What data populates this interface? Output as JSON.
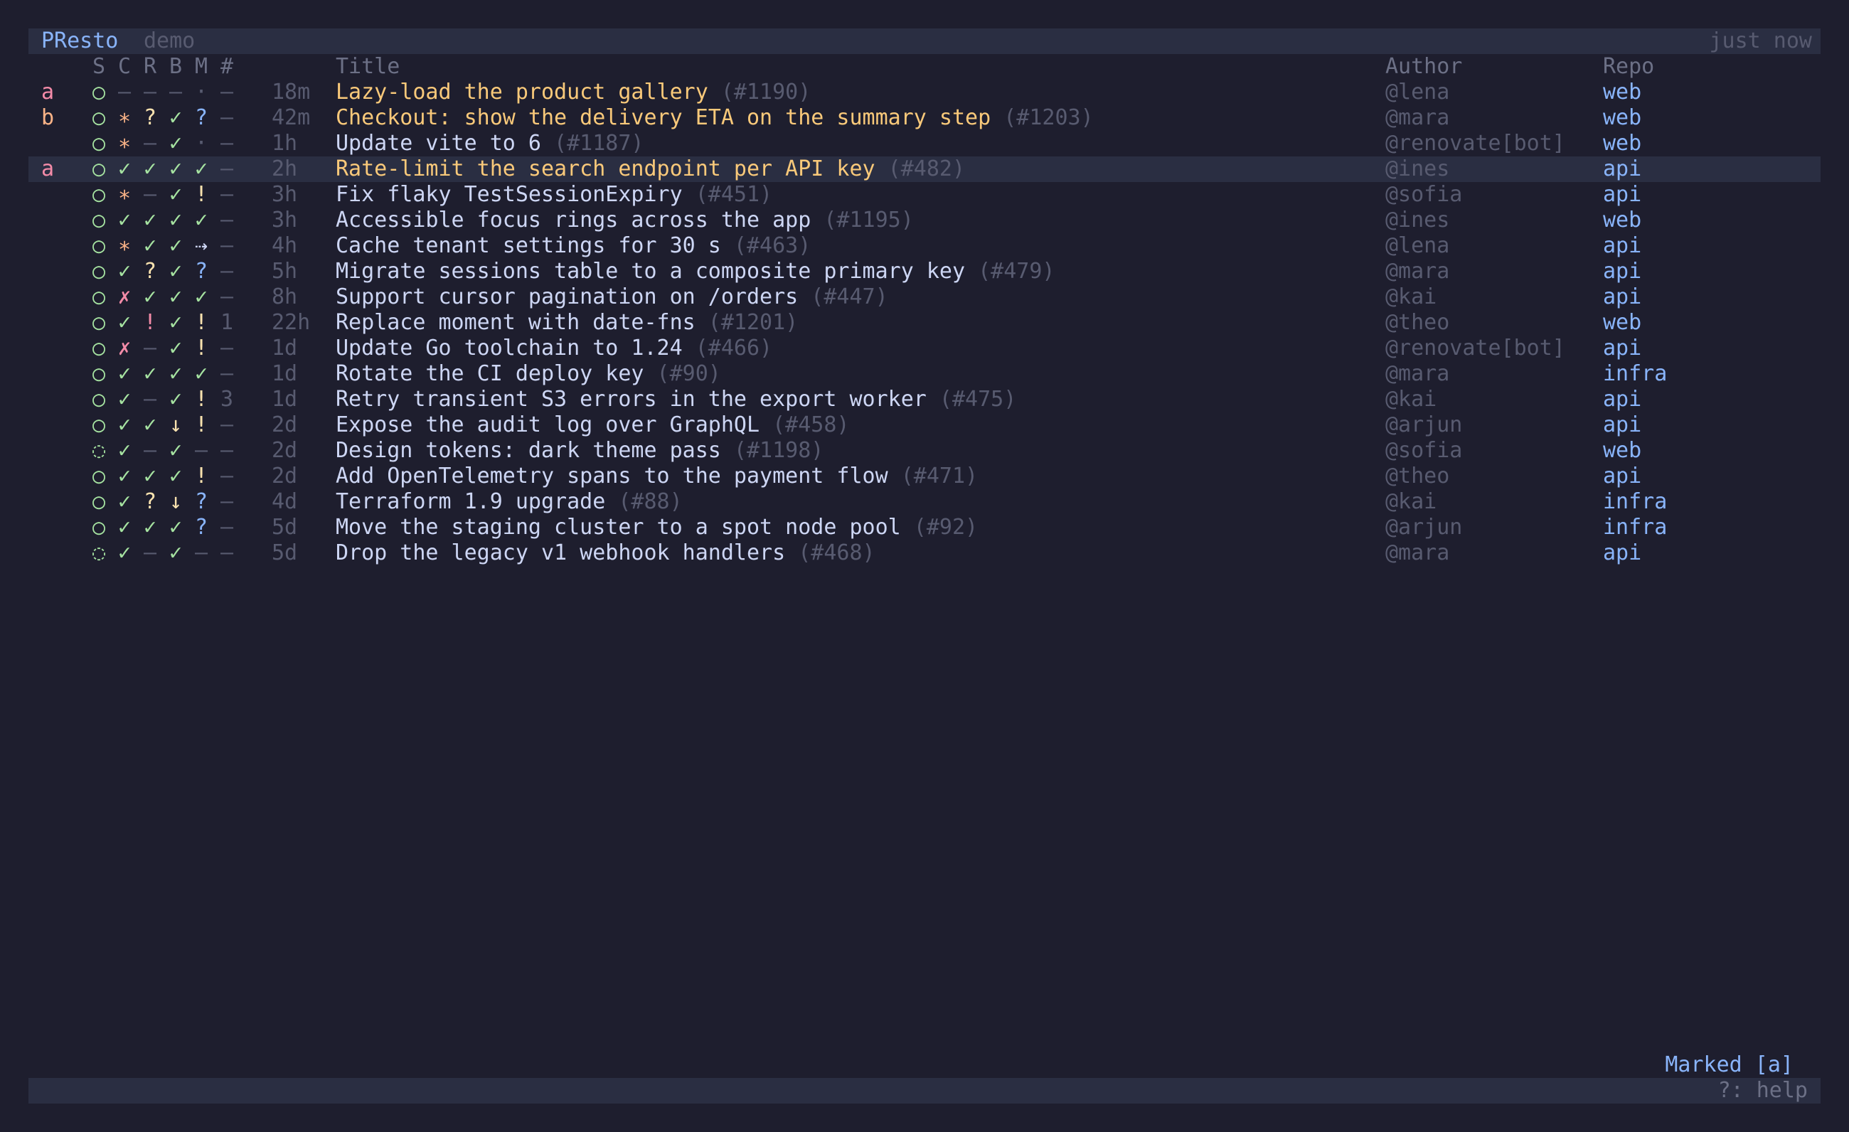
{
  "header": {
    "app_name": "PResto",
    "subtitle": "demo",
    "updated": "just now"
  },
  "columns": {
    "status": "S",
    "ci": "C",
    "review": "R",
    "branch": "B",
    "merge": "M",
    "count": "#",
    "title": "Title",
    "author": "Author",
    "repo": "Repo"
  },
  "colors": {
    "background": "#1e1e2e",
    "bar": "#2a2e42",
    "accent_blue": "#89b4fa",
    "green": "#a6e3a1",
    "yellow": "#f9e2af",
    "orange": "#fab387",
    "red": "#f38ba8",
    "dim": "#585b70"
  },
  "rows": [
    {
      "mark": "a",
      "cells": [
        "○",
        "–",
        "–",
        "–",
        "·",
        "–"
      ],
      "age": "18m",
      "title": "Lazy-load the product gallery",
      "number": "(#1190)",
      "author": "@lena",
      "repo": "web",
      "marked": true
    },
    {
      "mark": "b",
      "cells": [
        "○",
        "∗",
        "?",
        "✓",
        "?",
        "–"
      ],
      "age": "42m",
      "title": "Checkout: show the delivery ETA on the summary step",
      "number": "(#1203)",
      "author": "@mara",
      "repo": "web",
      "marked": true
    },
    {
      "mark": "",
      "cells": [
        "○",
        "∗",
        "–",
        "✓",
        "·",
        "–"
      ],
      "age": "1h",
      "title": "Update vite to 6",
      "number": "(#1187)",
      "author": "@renovate[bot]",
      "repo": "web"
    },
    {
      "mark": "a",
      "cells": [
        "○",
        "✓",
        "✓",
        "✓",
        "✓",
        "–"
      ],
      "age": "2h",
      "title": "Rate-limit the search endpoint per API key",
      "number": "(#482)",
      "author": "@ines",
      "repo": "api",
      "marked": true,
      "selected": true
    },
    {
      "mark": "",
      "cells": [
        "○",
        "∗",
        "–",
        "✓",
        "!",
        "–"
      ],
      "age": "3h",
      "title": "Fix flaky TestSessionExpiry",
      "number": "(#451)",
      "author": "@sofia",
      "repo": "api"
    },
    {
      "mark": "",
      "cells": [
        "○",
        "✓",
        "✓",
        "✓",
        "✓",
        "–"
      ],
      "age": "3h",
      "title": "Accessible focus rings across the app",
      "number": "(#1195)",
      "author": "@ines",
      "repo": "web"
    },
    {
      "mark": "",
      "cells": [
        "○",
        "∗",
        "✓",
        "✓",
        "⇢",
        "–"
      ],
      "age": "4h",
      "title": "Cache tenant settings for 30 s",
      "number": "(#463)",
      "author": "@lena",
      "repo": "api"
    },
    {
      "mark": "",
      "cells": [
        "○",
        "✓",
        "?",
        "✓",
        "?",
        "–"
      ],
      "age": "5h",
      "title": "Migrate sessions table to a composite primary key",
      "number": "(#479)",
      "author": "@mara",
      "repo": "api"
    },
    {
      "mark": "",
      "cells": [
        "○",
        "✗",
        "✓",
        "✓",
        "✓",
        "–"
      ],
      "age": "8h",
      "title": "Support cursor pagination on /orders",
      "number": "(#447)",
      "author": "@kai",
      "repo": "api"
    },
    {
      "mark": "",
      "cells": [
        "○",
        "✓",
        "!",
        "✓",
        "!",
        "1"
      ],
      "age": "22h",
      "title": "Replace moment with date-fns",
      "number": "(#1201)",
      "author": "@theo",
      "repo": "web"
    },
    {
      "mark": "",
      "cells": [
        "○",
        "✗",
        "–",
        "✓",
        "!",
        "–"
      ],
      "age": "1d",
      "title": "Update Go toolchain to 1.24",
      "number": "(#466)",
      "author": "@renovate[bot]",
      "repo": "api"
    },
    {
      "mark": "",
      "cells": [
        "○",
        "✓",
        "✓",
        "✓",
        "✓",
        "–"
      ],
      "age": "1d",
      "title": "Rotate the CI deploy key",
      "number": "(#90)",
      "author": "@mara",
      "repo": "infra"
    },
    {
      "mark": "",
      "cells": [
        "○",
        "✓",
        "–",
        "✓",
        "!",
        "3"
      ],
      "age": "1d",
      "title": "Retry transient S3 errors in the export worker",
      "number": "(#475)",
      "author": "@kai",
      "repo": "api"
    },
    {
      "mark": "",
      "cells": [
        "○",
        "✓",
        "✓",
        "↓",
        "!",
        "–"
      ],
      "age": "2d",
      "title": "Expose the audit log over GraphQL",
      "number": "(#458)",
      "author": "@arjun",
      "repo": "api"
    },
    {
      "mark": "",
      "cells": [
        "◌",
        "✓",
        "–",
        "✓",
        "–",
        "–"
      ],
      "age": "2d",
      "title": "Design tokens: dark theme pass",
      "number": "(#1198)",
      "author": "@sofia",
      "repo": "web"
    },
    {
      "mark": "",
      "cells": [
        "○",
        "✓",
        "✓",
        "✓",
        "!",
        "–"
      ],
      "age": "2d",
      "title": "Add OpenTelemetry spans to the payment flow",
      "number": "(#471)",
      "author": "@theo",
      "repo": "api"
    },
    {
      "mark": "",
      "cells": [
        "○",
        "✓",
        "?",
        "↓",
        "?",
        "–"
      ],
      "age": "4d",
      "title": "Terraform 1.9 upgrade",
      "number": "(#88)",
      "author": "@kai",
      "repo": "infra"
    },
    {
      "mark": "",
      "cells": [
        "○",
        "✓",
        "✓",
        "✓",
        "?",
        "–"
      ],
      "age": "5d",
      "title": "Move the staging cluster to a spot node pool",
      "number": "(#92)",
      "author": "@arjun",
      "repo": "infra"
    },
    {
      "mark": "",
      "cells": [
        "◌",
        "✓",
        "–",
        "✓",
        "–",
        "–"
      ],
      "age": "5d",
      "title": "Drop the legacy v1 webhook handlers",
      "number": "(#468)",
      "author": "@mara",
      "repo": "api"
    }
  ],
  "footer": {
    "marked": "Marked [a]",
    "help": "?: help"
  }
}
